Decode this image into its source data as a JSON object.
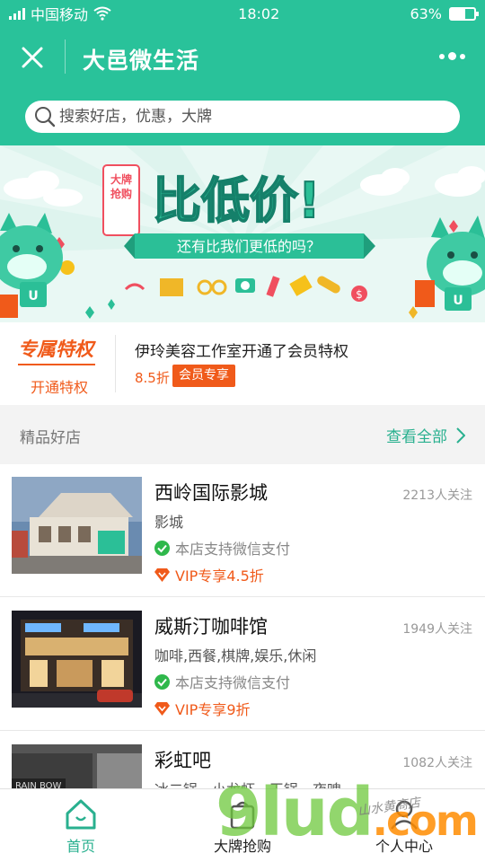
{
  "status_bar": {
    "carrier": "中国移动",
    "time": "18:02",
    "battery": "63%"
  },
  "header": {
    "title": "大邑微生活"
  },
  "search": {
    "placeholder": "搜索好店，优惠，大牌"
  },
  "banner": {
    "tag": "大牌抢购",
    "headline": "比低价!",
    "subline": "还有比我们更低的吗？"
  },
  "privilege": {
    "title": "专属特权",
    "link": "开通特权",
    "message": "伊玲美容工作室开通了会员特权",
    "discount": "8.5折",
    "badge": "会员专享"
  },
  "section": {
    "title": "精品好店",
    "more": "查看全部"
  },
  "shops": [
    {
      "name": "西岭国际影城",
      "followers": "2213人关注",
      "category": "影城",
      "payment": "本店支持微信支付",
      "vip": "VIP专享4.5折"
    },
    {
      "name": "威斯汀咖啡馆",
      "followers": "1949人关注",
      "category": "咖啡,西餐,棋牌,娱乐,休闲",
      "payment": "本店支持微信支付",
      "vip": "VIP专享9折"
    },
    {
      "name": "彩虹吧",
      "followers": "1082人关注",
      "category": "冰二锅　小龙虾　干锅　夜啤"
    }
  ],
  "tabs": [
    {
      "label": "首页",
      "icon": "home-icon"
    },
    {
      "label": "大牌抢购",
      "icon": "shopping-bag-icon"
    },
    {
      "label": "个人中心",
      "icon": "person-icon"
    }
  ],
  "watermark": {
    "text": "9lud",
    "tld": ".com",
    "caption": "山水黄商店"
  },
  "colors": {
    "brand": "#29c29a",
    "accent": "#f05a1a",
    "tab_active": "#29b08f"
  }
}
